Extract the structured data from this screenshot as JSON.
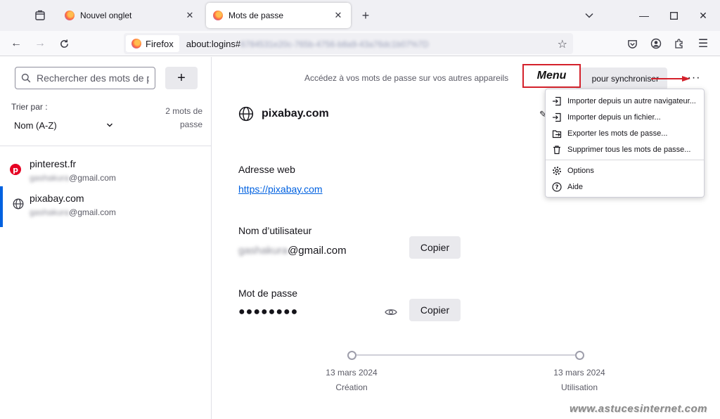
{
  "browser": {
    "tabs": [
      {
        "title": "Nouvel onglet",
        "active": false
      },
      {
        "title": "Mots de passe",
        "active": true
      }
    ],
    "identity_label": "Firefox",
    "url_visible": "about:logins#",
    "url_blurred": "6784531e20c-765b-4756-b8a9-43a76dc1b07%7D"
  },
  "sidebar": {
    "search_placeholder": "Rechercher des mots de p",
    "add_label": "+",
    "sort_label": "Trier par :",
    "sort_value": "Nom (A-Z)",
    "count_line1": "2 mots de",
    "count_line2": "passe",
    "logins": [
      {
        "site": "pinterest.fr",
        "user_hidden": "gashakura",
        "user_domain": "@gmail.com",
        "icon": "pinterest-icon"
      },
      {
        "site": "pixabay.com",
        "user_hidden": "gashakura",
        "user_domain": "@gmail.com",
        "icon": "globe-icon",
        "selected": true
      }
    ]
  },
  "main": {
    "sync_text": "Accédez à vos mots de passe sur vos autres appareils",
    "sync_button": "pour synchroniser",
    "menu_callout": "Menu",
    "more_label": "···",
    "title": "pixabay.com",
    "web_address_label": "Adresse web",
    "web_address": "https://pixabay.com",
    "username_label": "Nom d’utilisateur",
    "username_hidden": "gashakura",
    "username_domain": "@gmail.com",
    "copy_label": "Copier",
    "password_label": "Mot de passe",
    "password_mask": "●●●●●●●●",
    "timeline": [
      {
        "date": "13 mars 2024",
        "label": "Création"
      },
      {
        "date": "13 mars 2024",
        "label": "Utilisation"
      }
    ]
  },
  "menu": {
    "items": [
      {
        "label": "Importer depuis un autre navigateur...",
        "icon": "import-icon"
      },
      {
        "label": "Importer depuis un fichier...",
        "icon": "import-file-icon"
      },
      {
        "label": "Exporter les mots de passe...",
        "icon": "export-icon"
      },
      {
        "label": "Supprimer tous les mots de passe...",
        "icon": "trash-icon"
      },
      {
        "label": "Options",
        "icon": "gear-icon"
      },
      {
        "label": "Aide",
        "icon": "help-icon"
      }
    ]
  },
  "watermark": "www.astucesinternet.com",
  "colors": {
    "accent": "#0061e0",
    "callout_border": "#d4212b",
    "pinterest": "#e60023"
  }
}
